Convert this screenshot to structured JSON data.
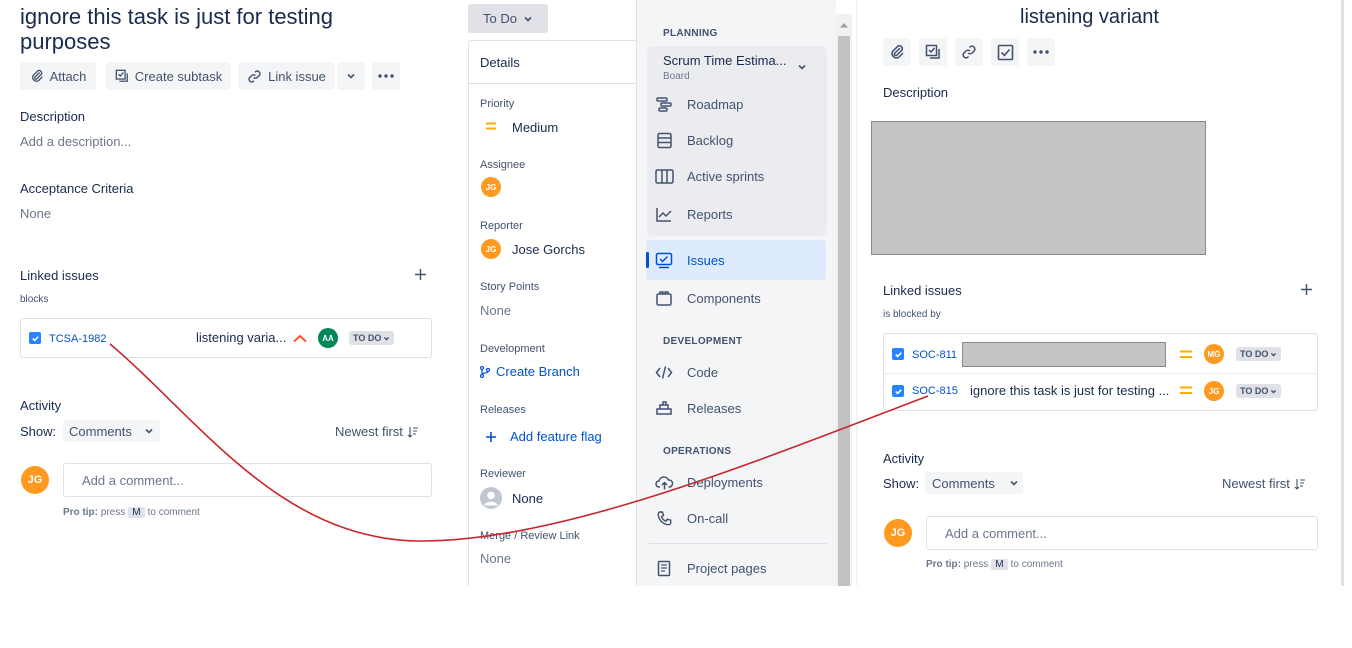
{
  "left": {
    "title_line1": "ignore this task is just for testing",
    "title_line2": "purposes",
    "toolbar": {
      "attach": "Attach",
      "create_subtask": "Create subtask",
      "link_issue": "Link issue"
    },
    "description_label": "Description",
    "description_placeholder": "Add a description...",
    "acceptance_label": "Acceptance Criteria",
    "acceptance_value": "None",
    "linked_label": "Linked issues",
    "relation": "blocks",
    "linked_item": {
      "key": "TCSA-1982",
      "summary": "listening varia...",
      "assignee": "AA",
      "status": "TO DO"
    },
    "activity_label": "Activity",
    "show_label": "Show:",
    "show_value": "Comments",
    "sort_label": "Newest first",
    "user_initials": "JG",
    "comment_placeholder": "Add a comment...",
    "protip_bold": "Pro tip:",
    "protip_press": "press",
    "protip_key": "M",
    "protip_rest": "to comment"
  },
  "middle": {
    "status_button": "To Do",
    "details_title": "Details",
    "priority_label": "Priority",
    "priority_value": "Medium",
    "assignee_label": "Assignee",
    "assignee_initials": "JG",
    "reporter_label": "Reporter",
    "reporter_initials": "JG",
    "reporter_name": "Jose Gorchs",
    "story_points_label": "Story Points",
    "story_points_value": "None",
    "development_label": "Development",
    "create_branch": "Create Branch",
    "releases_label": "Releases",
    "add_feature_flag": "Add feature flag",
    "reviewer_label": "Reviewer",
    "reviewer_value": "None",
    "merge_label": "Merge / Review Link",
    "merge_value": "None"
  },
  "sidebar": {
    "planning_header": "PLANNING",
    "board_name": "Scrum Time Estima...",
    "board_sub": "Board",
    "planning_items": [
      {
        "label": "Roadmap",
        "icon": "roadmap-icon"
      },
      {
        "label": "Backlog",
        "icon": "backlog-icon"
      },
      {
        "label": "Active sprints",
        "icon": "sprints-icon"
      },
      {
        "label": "Reports",
        "icon": "reports-icon"
      }
    ],
    "issues": "Issues",
    "components": "Components",
    "development_header": "DEVELOPMENT",
    "code": "Code",
    "releases": "Releases",
    "operations_header": "OPERATIONS",
    "deployments": "Deployments",
    "on_call": "On-call",
    "project_pages": "Project pages"
  },
  "right": {
    "title": "listening variant",
    "description_label": "Description",
    "linked_label": "Linked issues",
    "relation": "is blocked by",
    "linked_items": [
      {
        "key": "SOC-811",
        "summary": "",
        "assignee": "MG",
        "status": "TO DO"
      },
      {
        "key": "SOC-815",
        "summary": "ignore this task is just for testing ...",
        "assignee": "JG",
        "status": "TO DO"
      }
    ],
    "activity_label": "Activity",
    "show_label": "Show:",
    "show_value": "Comments",
    "sort_label": "Newest first",
    "user_initials": "JG",
    "comment_placeholder": "Add a comment...",
    "protip_bold": "Pro tip:",
    "protip_press": "press",
    "protip_key": "M",
    "protip_rest": "to comment"
  },
  "colors": {
    "accent": "#0052cc",
    "priority_medium": "#ffab00",
    "priority_high": "#ff5630",
    "avatar_orange": "#ff991f",
    "avatar_green": "#00875a",
    "annotation_arrow": "#c9252c"
  }
}
